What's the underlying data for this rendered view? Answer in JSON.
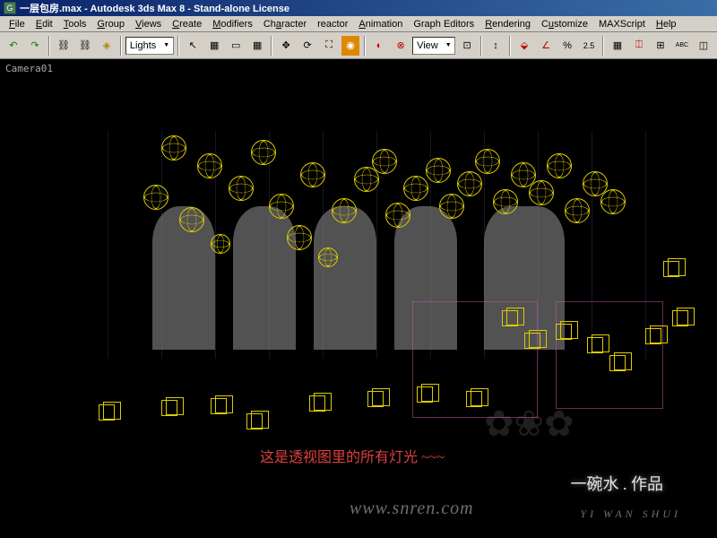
{
  "window": {
    "title": "一层包房.max - Autodesk 3ds Max 8  - Stand-alone License"
  },
  "menu": {
    "items": [
      "File",
      "Edit",
      "Tools",
      "Group",
      "Views",
      "Create",
      "Modifiers",
      "Character",
      "reactor",
      "Animation",
      "Graph Editors",
      "Rendering",
      "Customize",
      "MAXScript",
      "Help"
    ]
  },
  "toolbar": {
    "dropdown1": "Lights",
    "dropdown2": "View",
    "snap_value": "2.5"
  },
  "viewport": {
    "label": "Camera01"
  },
  "annotation": {
    "text": "这是透视图里的所有灯光 ~~~"
  },
  "watermark": {
    "url": "www.snren.com",
    "signature": "一碗水 . 作品",
    "pinyin": "YI  WAN  SHUI"
  }
}
